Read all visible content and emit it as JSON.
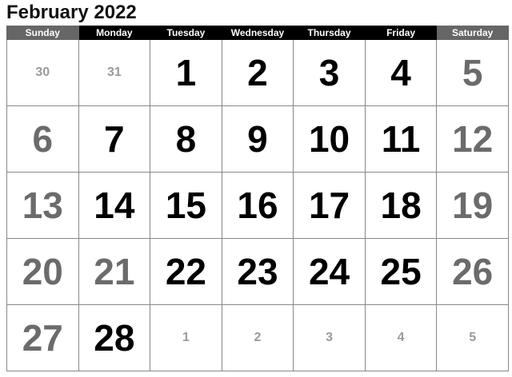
{
  "title": "February 2022",
  "weekdays": [
    "Sunday",
    "Monday",
    "Tuesday",
    "Wednesday",
    "Thursday",
    "Friday",
    "Saturday"
  ],
  "weeks": [
    [
      {
        "day": "30",
        "kind": "adjacent-month"
      },
      {
        "day": "31",
        "kind": "adjacent-month"
      },
      {
        "day": "1",
        "kind": "current-month"
      },
      {
        "day": "2",
        "kind": "current-month"
      },
      {
        "day": "3",
        "kind": "current-month"
      },
      {
        "day": "4",
        "kind": "current-month"
      },
      {
        "day": "5",
        "kind": "weekend"
      }
    ],
    [
      {
        "day": "6",
        "kind": "weekend"
      },
      {
        "day": "7",
        "kind": "current-month"
      },
      {
        "day": "8",
        "kind": "current-month"
      },
      {
        "day": "9",
        "kind": "current-month"
      },
      {
        "day": "10",
        "kind": "current-month"
      },
      {
        "day": "11",
        "kind": "current-month"
      },
      {
        "day": "12",
        "kind": "weekend"
      }
    ],
    [
      {
        "day": "13",
        "kind": "weekend"
      },
      {
        "day": "14",
        "kind": "current-month"
      },
      {
        "day": "15",
        "kind": "current-month"
      },
      {
        "day": "16",
        "kind": "current-month"
      },
      {
        "day": "17",
        "kind": "current-month"
      },
      {
        "day": "18",
        "kind": "current-month"
      },
      {
        "day": "19",
        "kind": "weekend"
      }
    ],
    [
      {
        "day": "20",
        "kind": "weekend"
      },
      {
        "day": "21",
        "kind": "holiday"
      },
      {
        "day": "22",
        "kind": "current-month"
      },
      {
        "day": "23",
        "kind": "current-month"
      },
      {
        "day": "24",
        "kind": "current-month"
      },
      {
        "day": "25",
        "kind": "current-month"
      },
      {
        "day": "26",
        "kind": "weekend"
      }
    ],
    [
      {
        "day": "27",
        "kind": "weekend"
      },
      {
        "day": "28",
        "kind": "current-month"
      },
      {
        "day": "1",
        "kind": "adjacent-month"
      },
      {
        "day": "2",
        "kind": "adjacent-month"
      },
      {
        "day": "3",
        "kind": "adjacent-month"
      },
      {
        "day": "4",
        "kind": "adjacent-month"
      },
      {
        "day": "5",
        "kind": "adjacent-month"
      }
    ]
  ],
  "colors": {
    "weekday_header": "#000000",
    "weekend_header": "#666666",
    "current_day_text": "#000000",
    "weekend_day_text": "#6b6b6b",
    "adjacent_day_text": "#9a9a9a"
  }
}
